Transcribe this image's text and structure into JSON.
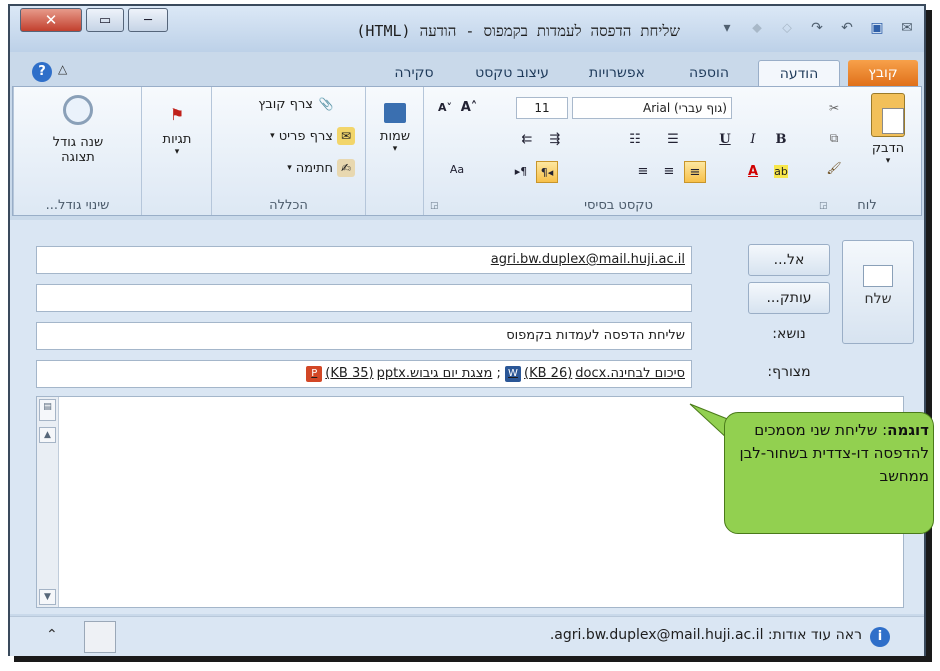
{
  "window": {
    "title": "שליחת הדפסה לעמדות בקמפוס  -  הודעה (HTML)",
    "close_glyph": "✕",
    "max_glyph": "▭",
    "min_glyph": "─"
  },
  "qat_icons": [
    "save-icon",
    "undo-icon",
    "redo-icon",
    "up-arrow-icon",
    "down-arrow-icon"
  ],
  "tabs": {
    "file": "קובץ",
    "message": "הודעה",
    "insert": "הוספה",
    "options": "אפשרויות",
    "format_text": "עיצוב טקסט",
    "review": "סקירה"
  },
  "ribbon": {
    "clipboard": {
      "paste": "הדבק",
      "label": "לוח"
    },
    "basic_text": {
      "font": "(גוף עברי) Arial",
      "size": "11",
      "label": "טקסט בסיסי",
      "bold": "B",
      "italic": "I",
      "underline": "U"
    },
    "names": {
      "names": "שמות"
    },
    "include": {
      "attach_file": "צרף קובץ",
      "attach_item": "צרף פריט",
      "signature": "חתימה",
      "label": "הכללה"
    },
    "tags": {
      "tags": "תגיות"
    },
    "zoom": {
      "zoom_line1": "שנה גודל",
      "zoom_line2": "תצוגה",
      "label": "שינוי גודל..."
    }
  },
  "compose": {
    "send": "שלח",
    "to_button": "אל...",
    "cc_button": "עותק...",
    "subject_label": "נושא:",
    "attachment_label": "מצורף:",
    "to_value": "agri.bw.duplex@mail.huji.ac.il",
    "cc_value": "",
    "subject_value": "שליחת הדפסה לעמדות בקמפוס",
    "attachments": [
      {
        "name": "סיכום לבחינה.docx",
        "size": "(26 KB)",
        "type": "word"
      },
      {
        "name": "מצגת יום גיבוש.pptx",
        "size": "(35 KB)",
        "type": "powerpoint"
      }
    ],
    "attachment_separator": ";"
  },
  "people_pane": {
    "text": "ראה עוד אודות: agri.bw.duplex@mail.huji.ac.il."
  },
  "callout": {
    "bold_prefix": "דוגמה",
    "text": ": שליחת שני מסמכים להדפסה דו-צדדית בשחור-לבן ממחשב"
  },
  "colors": {
    "file_tab": "#e0701a",
    "callout": "#92d050",
    "highlight": "#f7c04a",
    "font_color": "#d00000"
  }
}
